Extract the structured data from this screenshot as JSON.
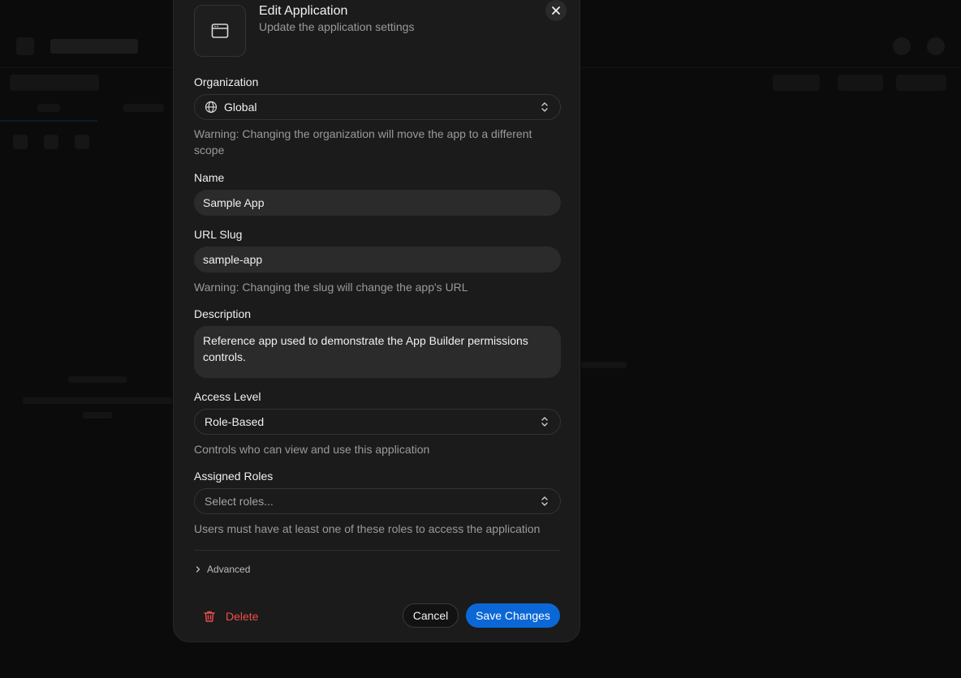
{
  "modal": {
    "title": "Edit Application",
    "subtitle": "Update the application settings",
    "app_icon": "browser-window-icon",
    "close_icon": "close-icon"
  },
  "form": {
    "organization": {
      "label": "Organization",
      "value": "Global",
      "icon": "globe-icon",
      "hint": "Warning: Changing the organization will move the app to a different scope"
    },
    "name": {
      "label": "Name",
      "value": "Sample App"
    },
    "url_slug": {
      "label": "URL Slug",
      "value": "sample-app",
      "hint": "Warning: Changing the slug will change the app's URL"
    },
    "description": {
      "label": "Description",
      "value": "Reference app used to demonstrate the App Builder permissions controls."
    },
    "access_level": {
      "label": "Access Level",
      "value": "Role-Based",
      "hint": "Controls who can view and use this application"
    },
    "assigned_roles": {
      "label": "Assigned Roles",
      "placeholder": "Select roles...",
      "hint": "Users must have at least one of these roles to access the application"
    },
    "advanced": {
      "label": "Advanced",
      "icon": "chevron-right-icon"
    }
  },
  "footer": {
    "delete_label": "Delete",
    "delete_icon": "trash-icon",
    "cancel_label": "Cancel",
    "save_label": "Save Changes"
  },
  "colors": {
    "accent": "#0b67d6",
    "danger": "#ef4d4d",
    "modal_bg": "#1b1b1b",
    "input_bg": "#2b2b2b"
  }
}
